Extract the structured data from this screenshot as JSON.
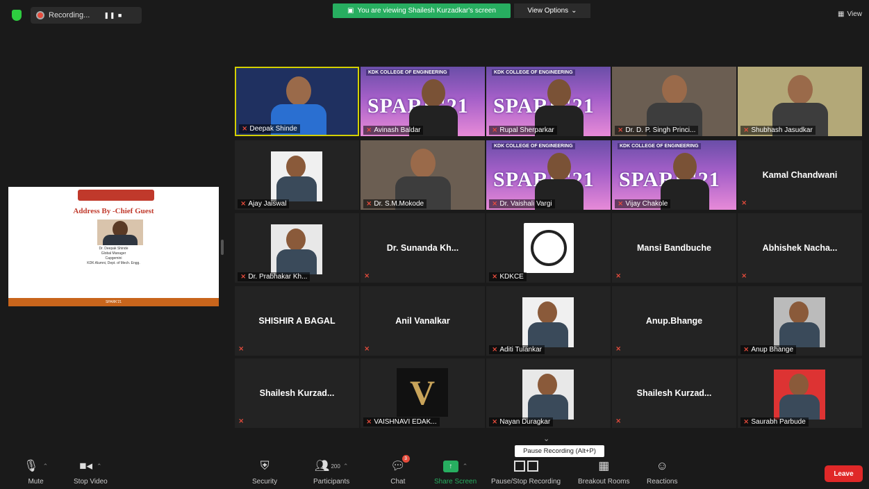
{
  "top_bar": {
    "recording_label": "Recording...",
    "recording_controls": "❚❚ ■",
    "share_banner": "You are viewing Shailesh Kurzadkar's screen",
    "view_options": "View Options",
    "view_label": "View"
  },
  "shared_screen": {
    "slide_title": "Address By -Chief Guest",
    "caption_name": "Dr. Deepak Shinde",
    "caption_line2": "Global Manager",
    "caption_line3": "Capgemini",
    "caption_line4": "KDK Alumni, Dept. of Mech. Engg.",
    "footer": "SPARK'21"
  },
  "poster": {
    "college": "KDK COLLEGE OF ENGINEERING",
    "event": "SPARK'21"
  },
  "participants": [
    {
      "name": "Deepak Shinde",
      "row": 0,
      "col": 0,
      "kind": "video",
      "active": true
    },
    {
      "name": "Avinash Baldar",
      "row": 0,
      "col": 1,
      "kind": "poster-video"
    },
    {
      "name": "Rupal Sherparkar",
      "row": 0,
      "col": 2,
      "kind": "poster-video"
    },
    {
      "name": "Dr. D. P. Singh Princi...",
      "row": 0,
      "col": 3,
      "kind": "video"
    },
    {
      "name": "Shubhash Jasudkar",
      "row": 0,
      "col": 4,
      "kind": "video"
    },
    {
      "name": "Ajay Jaiswal",
      "row": 1,
      "col": 0,
      "kind": "photo"
    },
    {
      "name": "Dr. S.M.Mokode",
      "row": 1,
      "col": 1,
      "kind": "video"
    },
    {
      "name": "Dr. Vaishali Vargi",
      "row": 1,
      "col": 2,
      "kind": "poster-video"
    },
    {
      "name": "Vijay Chakole",
      "row": 1,
      "col": 3,
      "kind": "poster-video"
    },
    {
      "name": "Kamal Chandwani",
      "row": 1,
      "col": 4,
      "kind": "text"
    },
    {
      "name": "Dr. Prabhakar Kh...",
      "row": 2,
      "col": 0,
      "kind": "photo"
    },
    {
      "name": "Dr. Sunanda Kh...",
      "row": 2,
      "col": 1,
      "kind": "text"
    },
    {
      "name": "KDKCE",
      "row": 2,
      "col": 2,
      "kind": "logo"
    },
    {
      "name": "Mansi Bandbuche",
      "row": 2,
      "col": 3,
      "kind": "text"
    },
    {
      "name": "Abhishek Nacha...",
      "row": 2,
      "col": 4,
      "kind": "text"
    },
    {
      "name": "SHISHIR A BAGAL",
      "row": 3,
      "col": 0,
      "kind": "text"
    },
    {
      "name": "Anil Vanalkar",
      "row": 3,
      "col": 1,
      "kind": "text"
    },
    {
      "name": "Aditi Tulankar",
      "row": 3,
      "col": 2,
      "kind": "photo"
    },
    {
      "name": "Anup.Bhange",
      "row": 3,
      "col": 3,
      "kind": "text"
    },
    {
      "name": "Anup Bhange",
      "row": 3,
      "col": 4,
      "kind": "photo"
    },
    {
      "name": "Shailesh Kurzad...",
      "row": 4,
      "col": 0,
      "kind": "text"
    },
    {
      "name": "VAISHNAVI EDAK...",
      "row": 4,
      "col": 1,
      "kind": "v-logo"
    },
    {
      "name": "Nayan Duragkar",
      "row": 4,
      "col": 2,
      "kind": "photo"
    },
    {
      "name": "Shailesh Kurzad...",
      "row": 4,
      "col": 3,
      "kind": "text"
    },
    {
      "name": "Saurabh Parbude",
      "row": 4,
      "col": 4,
      "kind": "photo"
    }
  ],
  "toolbar": {
    "mute": "Mute",
    "stop_video": "Stop Video",
    "security": "Security",
    "participants": "Participants",
    "participants_count": "200",
    "chat": "Chat",
    "chat_badge": "3",
    "share_screen": "Share Screen",
    "pause_stop_recording": "Pause/Stop Recording",
    "breakout_rooms": "Breakout Rooms",
    "reactions": "Reactions",
    "leave": "Leave",
    "tooltip": "Pause Recording (Alt+P)"
  },
  "colors": {
    "background": "#1a1a1a",
    "tile": "#232323",
    "active_border": "#d4d000",
    "share_green": "#27ae60",
    "leave_red": "#e02828",
    "muted_red": "#e74c3c"
  }
}
